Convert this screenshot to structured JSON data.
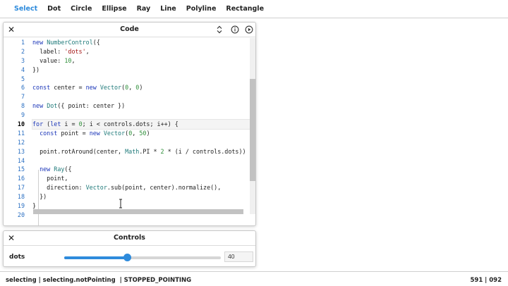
{
  "toolbar": {
    "tools": [
      "Select",
      "Dot",
      "Circle",
      "Ellipse",
      "Ray",
      "Line",
      "Polyline",
      "Rectangle"
    ],
    "active_tool": "Select"
  },
  "code_panel": {
    "title": "Code",
    "close_icon": "close-icon",
    "header_icons": [
      "collapse-icon",
      "info-icon",
      "play-icon"
    ],
    "current_line": 10,
    "line_numbers": [
      "1",
      "2",
      "3",
      "4",
      "5",
      "6",
      "7",
      "8",
      "9",
      "10",
      "11",
      "12",
      "13",
      "14",
      "15",
      "16",
      "17",
      "18",
      "19",
      "20"
    ],
    "code_lines": [
      "new NumberControl({",
      "  label: 'dots',",
      "  value: 10,",
      "})",
      "",
      "const center = new Vector(0, 0)",
      "",
      "new Dot({ point: center })",
      "",
      "for (let i = 0; i < controls.dots; i++) {",
      "  const point = new Vector(0, 50)",
      "",
      "  point.rotAround(center, Math.PI * 2 * (i / controls.dots))",
      "",
      "  new Ray({",
      "    point,",
      "    direction: Vector.sub(point, center).normalize(),",
      "  })",
      "}",
      ""
    ]
  },
  "controls_panel": {
    "title": "Controls",
    "close_icon": "close-icon",
    "control": {
      "label": "dots",
      "value": "40",
      "slider_fraction": 0.4
    }
  },
  "status": {
    "left": "selecting | selecting.notPointing  | STOPPED_POINTING",
    "right": "591 | 092"
  },
  "colors": {
    "accent": "#2e8bdc",
    "keyword": "#1a35b8",
    "class_name": "#1f7a7a",
    "string": "#a31515",
    "number": "#2f8f3a",
    "line_number": "#2a6fc2"
  }
}
